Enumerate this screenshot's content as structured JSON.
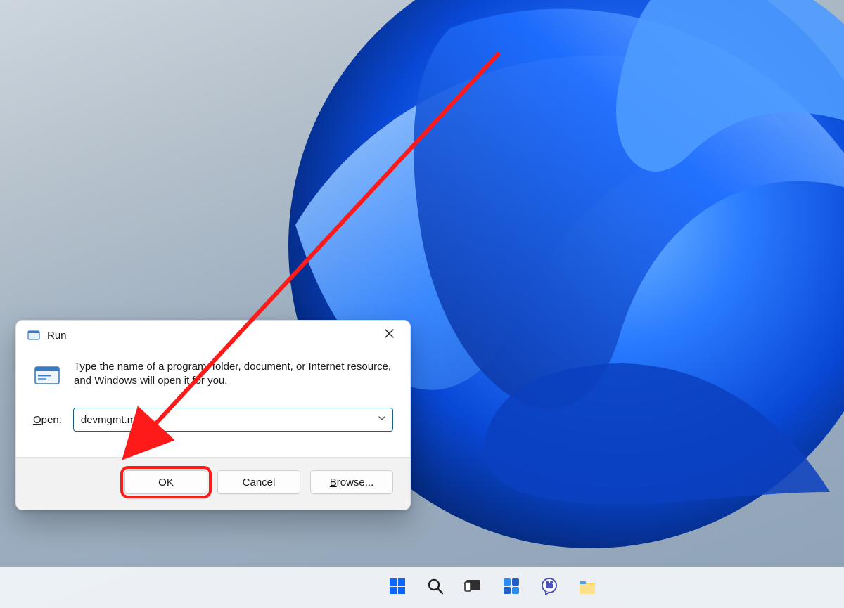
{
  "colors": {
    "annotation": "#ff1a1a",
    "accent_blue": "#0a66ff",
    "dialog_border_focus": "#1f5f87"
  },
  "run_dialog": {
    "title": "Run",
    "description": "Type the name of a program, folder, document, or Internet resource, and Windows will open it for you.",
    "open_label_prefix_ul": "O",
    "open_label_rest": "pen:",
    "input_value": "devmgmt.msc",
    "buttons": {
      "ok": "OK",
      "cancel": "Cancel",
      "browse_prefix_ul": "B",
      "browse_rest": "rowse..."
    }
  },
  "taskbar": {
    "items": [
      {
        "name": "start-icon"
      },
      {
        "name": "search-icon"
      },
      {
        "name": "task-view-icon"
      },
      {
        "name": "widgets-icon"
      },
      {
        "name": "chat-icon"
      },
      {
        "name": "file-explorer-icon"
      }
    ]
  }
}
